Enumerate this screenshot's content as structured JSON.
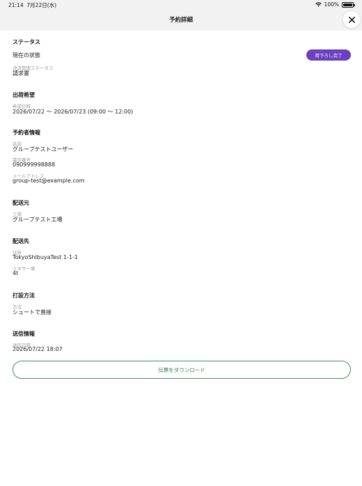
{
  "status_bar": {
    "time": "21:14",
    "date": "7月22日(水)",
    "battery": "100%"
  },
  "header": {
    "title": "予約詳細",
    "close_icon": "close-icon"
  },
  "status_section": {
    "title": "ステータス",
    "current_state_label": "現在の状態",
    "current_state_badge": "荷下ろし完了",
    "payment_label": "決済管理ステータス",
    "payment_value": "請求書"
  },
  "delivery_request": {
    "title": "出荷希望",
    "datetime_label": "希望日時",
    "datetime_value": "2026/07/22 ～ 2026/07/23 (09:00 ～ 12:00)"
  },
  "reserver": {
    "title": "予約者情報",
    "name_label": "名前",
    "name_value": "グループテストユーザー",
    "phone_label": "電話番号",
    "phone_value": "090999998888",
    "email_label": "メールアドレス",
    "email_value": "group-test@example.com"
  },
  "origin": {
    "title": "配送元",
    "factory_label": "工場",
    "factory_value": "グループテスト工場"
  },
  "destination": {
    "title": "配送先",
    "address_label": "住所",
    "address_value": "TokyoShibuyaTest 1-1-1",
    "mixer_label": "ミキサー車",
    "mixer_value": "4t"
  },
  "pouring": {
    "title": "打設方法",
    "method_label": "方法",
    "method_value": "シュートで直接"
  },
  "sent_info": {
    "title": "送信情報",
    "sent_label": "送信日時",
    "sent_value": "2026/07/22 18:07"
  },
  "actions": {
    "download_label": "伝票をダウンロード"
  },
  "colors": {
    "accent_purple": "#6a3fc0",
    "accent_green": "#2e7d55",
    "header_bg": "#f2f2f2"
  }
}
